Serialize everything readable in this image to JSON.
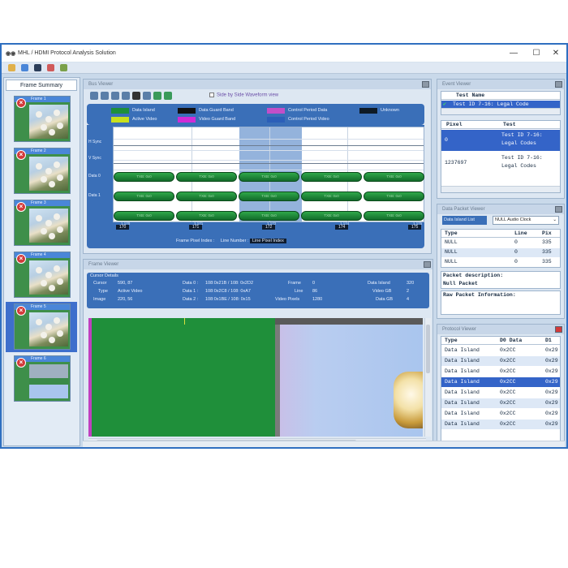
{
  "window": {
    "title": "MHL / HDMI Protocol Analysis Solution",
    "minimize": "—",
    "maximize": "☐",
    "close": "✕"
  },
  "colors": {
    "window_border": "#2f6fc0",
    "panel_blue": "#3a6fb8",
    "green": "#1a8a36",
    "selection": "#3464c8",
    "highlight_magenta": "#c040c0"
  },
  "frame_summary": {
    "tab": "Frame Summary",
    "frames": [
      {
        "label": "Frame 1",
        "selected": false
      },
      {
        "label": "Frame 2",
        "selected": false
      },
      {
        "label": "Frame 3",
        "selected": false
      },
      {
        "label": "Frame 4",
        "selected": false
      },
      {
        "label": "Frame 5",
        "selected": true
      },
      {
        "label": "Frame 6",
        "selected": false
      }
    ]
  },
  "bus_viewer": {
    "title": "Bus Viewer",
    "side_by_side": "Side by Side Waveform view",
    "legend": [
      {
        "label": "Data Island",
        "color": "#1f8f3a"
      },
      {
        "label": "Data Guard Band",
        "color": "#111111"
      },
      {
        "label": "Control Period Data",
        "color": "#c24fc8"
      },
      {
        "label": "Unknown",
        "color": "#0e1a26"
      },
      {
        "label": "Active Video",
        "color": "#c8e01e"
      },
      {
        "label": "Video Guard Band",
        "color": "#d02bd6"
      },
      {
        "label": "Control Period Video",
        "color": "#2c5fb8"
      }
    ],
    "signals": [
      "H Sync",
      "V Sync",
      "Data 0",
      "Data 1"
    ],
    "pill_text": "TXB: 0x0",
    "indices": [
      "170",
      "171",
      "172",
      "174",
      "175"
    ],
    "ticks": [
      "1,170",
      "1,171",
      "1,172",
      "1,174",
      "1,175"
    ],
    "footer_frame": "Frame Pixel Index :",
    "footer_line": "Line Number :",
    "footer_selected": "Line Pixel Index"
  },
  "frame_viewer": {
    "title": "Frame Viewer",
    "cursor_details_title": "Cursor Details",
    "cursor_label": "Cursor",
    "cursor_value": "590, 87",
    "type_label": "Type",
    "type_value": "Active Video",
    "image_label": "Image",
    "image_value": "220, 56",
    "data0_label": "Data 0 :",
    "data0_value": "108:0x21B / 108: 0x2D2",
    "data1_label": "Data 1 :",
    "data1_value": "108:0x2C8 / 108: 0xA7",
    "data2_label": "Data 2 :",
    "data2_value": "108:0x1BE / 108: 0x15",
    "frame_label": "Frame",
    "frame_value": "0",
    "line_label": "Line",
    "line_value": "86",
    "video_pixels_label": "Video Pixels",
    "video_pixels_value": "1280",
    "data_island_label": "Data Island",
    "data_island_value": "320",
    "video_gb_label": "Video GB",
    "video_gb_value": "2",
    "data_gb_label": "Data GB",
    "data_gb_value": "4"
  },
  "event_viewer": {
    "title": "Event Viewer",
    "header": "Test Name",
    "test_name": "Test ID 7-16: Legal Code",
    "col_pixel": "Pixel",
    "col_test": "Test",
    "rows": [
      {
        "pixel": "0",
        "test_line1": "Test ID 7-16:",
        "test_line2": "Legal Codes",
        "selected": true
      },
      {
        "pixel": "1237697",
        "test_line1": "Test ID 7-16:",
        "test_line2": "Legal Codes",
        "selected": false
      }
    ]
  },
  "data_packet_viewer": {
    "title": "Data Packet Viewer",
    "list_label": "Data Island List",
    "list_value": "NULL Audio Clock",
    "col_type": "Type",
    "col_line": "Line",
    "col_pix": "Pix",
    "rows": [
      {
        "type": "NULL",
        "line": "0",
        "pix": "335"
      },
      {
        "type": "NULL",
        "line": "0",
        "pix": "335"
      },
      {
        "type": "NULL",
        "line": "0",
        "pix": "335"
      }
    ],
    "packet_description_label": "Packet description:",
    "packet_description_value": "Null Packet",
    "raw_packet_label": "Raw Packet Information:"
  },
  "protocol_viewer": {
    "title": "Protocol Viewer",
    "col_type": "Type",
    "col_d0": "D0 Data",
    "col_d1": "D1",
    "rows": [
      {
        "type": "Data Island",
        "d0": "0x2CC",
        "d1": "0x29",
        "selected": false
      },
      {
        "type": "Data Island",
        "d0": "0x2CC",
        "d1": "0x29",
        "selected": false
      },
      {
        "type": "Data Island",
        "d0": "0x2CC",
        "d1": "0x29",
        "selected": false
      },
      {
        "type": "Data Island",
        "d0": "0x2CC",
        "d1": "0x29",
        "selected": true
      },
      {
        "type": "Data Island",
        "d0": "0x2CC",
        "d1": "0x29",
        "selected": false
      },
      {
        "type": "Data Island",
        "d0": "0x2CC",
        "d1": "0x29",
        "selected": false
      },
      {
        "type": "Data Island",
        "d0": "0x2CC",
        "d1": "0x29",
        "selected": false
      },
      {
        "type": "Data Island",
        "d0": "0x2CC",
        "d1": "0x29",
        "selected": false
      }
    ]
  }
}
